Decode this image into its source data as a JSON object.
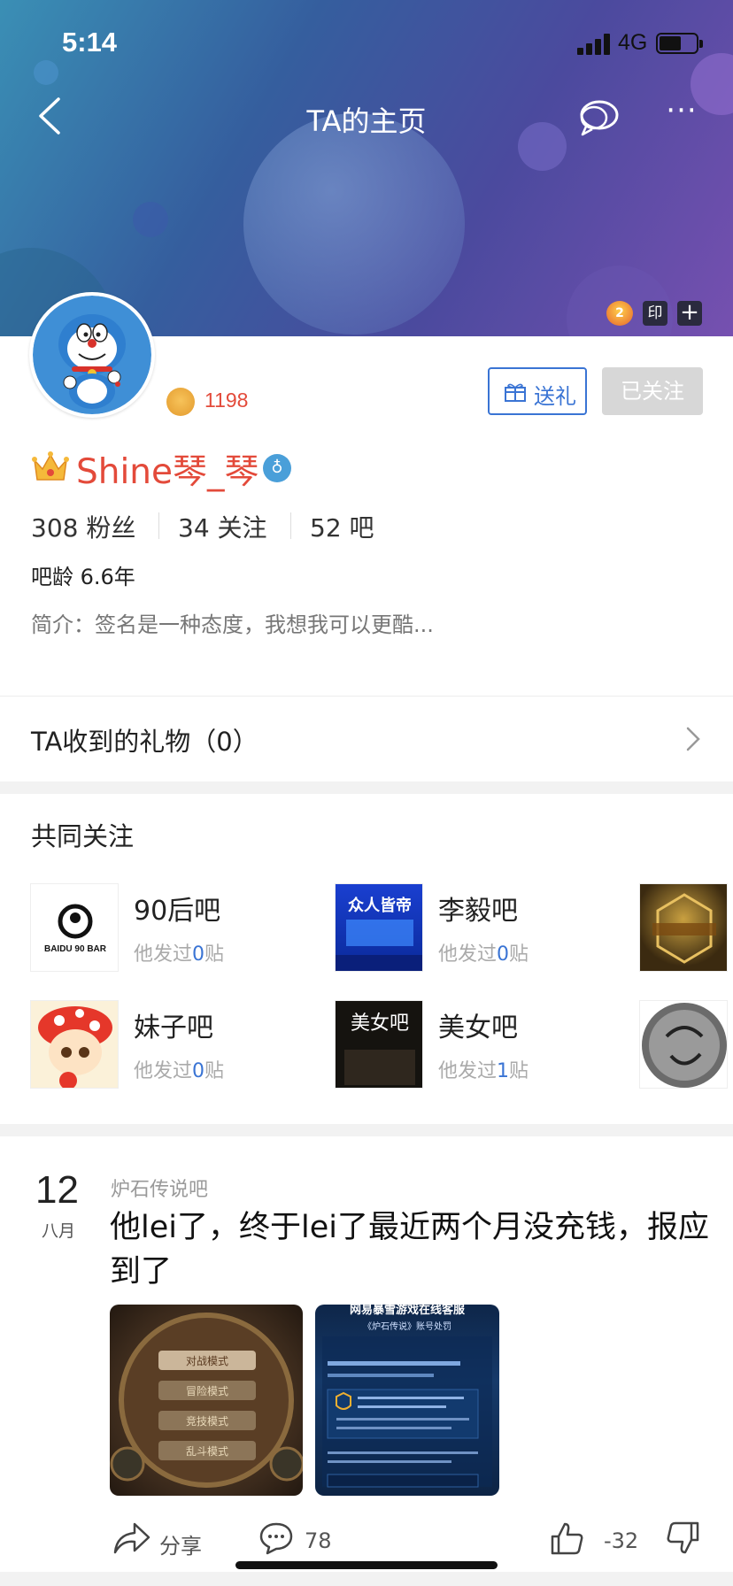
{
  "status_bar": {
    "time": "5:14",
    "network": "4G"
  },
  "nav": {
    "title": "TA的主页",
    "back_icon": "back-icon",
    "chat_icon": "chat-icon",
    "more_label": "···"
  },
  "banner_badges": {
    "fire": "2",
    "yin": "印",
    "plus": "+"
  },
  "profile": {
    "level_value": "1198",
    "gift_button": "送礼",
    "follow_button": "已关注",
    "username": "Shine琴_琴",
    "verify_icon": "♁",
    "stats": {
      "fans": "308 粉丝",
      "following": "34 关注",
      "bars": "52 吧"
    },
    "age": "吧龄 6.6年",
    "bio": "简介：签名是一种态度，我想我可以更酷..."
  },
  "gifts_row": {
    "label": "TA收到的礼物（0）"
  },
  "common_follow": {
    "title": "共同关注",
    "items": [
      {
        "name": "90后吧",
        "sub_prefix": "他发过",
        "count": "0",
        "sub_suffix": "贴",
        "img_text": "BAIDU 90 BAR"
      },
      {
        "name": "李毅吧",
        "sub_prefix": "他发过",
        "count": "0",
        "sub_suffix": "贴",
        "img_text": "众人皆帝"
      },
      {
        "name": "妹子吧",
        "sub_prefix": "他发过",
        "count": "0",
        "sub_suffix": "贴"
      },
      {
        "name": "美女吧",
        "sub_prefix": "他发过",
        "count": "1",
        "sub_suffix": "贴",
        "img_text": "美女吧"
      }
    ]
  },
  "post": {
    "day": "12",
    "month": "八月",
    "forum": "炉石传说吧",
    "title": "他lei了，终于lei了最近两个月没充钱，报应到了",
    "img1_labels": [
      "对战模式",
      "冒险模式",
      "竞技模式",
      "乱斗模式"
    ],
    "img2_header": "网易暴雪游戏在线客服",
    "img2_sub": "《炉石传说》账号处罚",
    "actions": {
      "share": "分享",
      "comments": "78",
      "votes": "-32"
    }
  },
  "colors": {
    "accent_red": "#e34a3a",
    "accent_blue": "#3a74d4"
  }
}
